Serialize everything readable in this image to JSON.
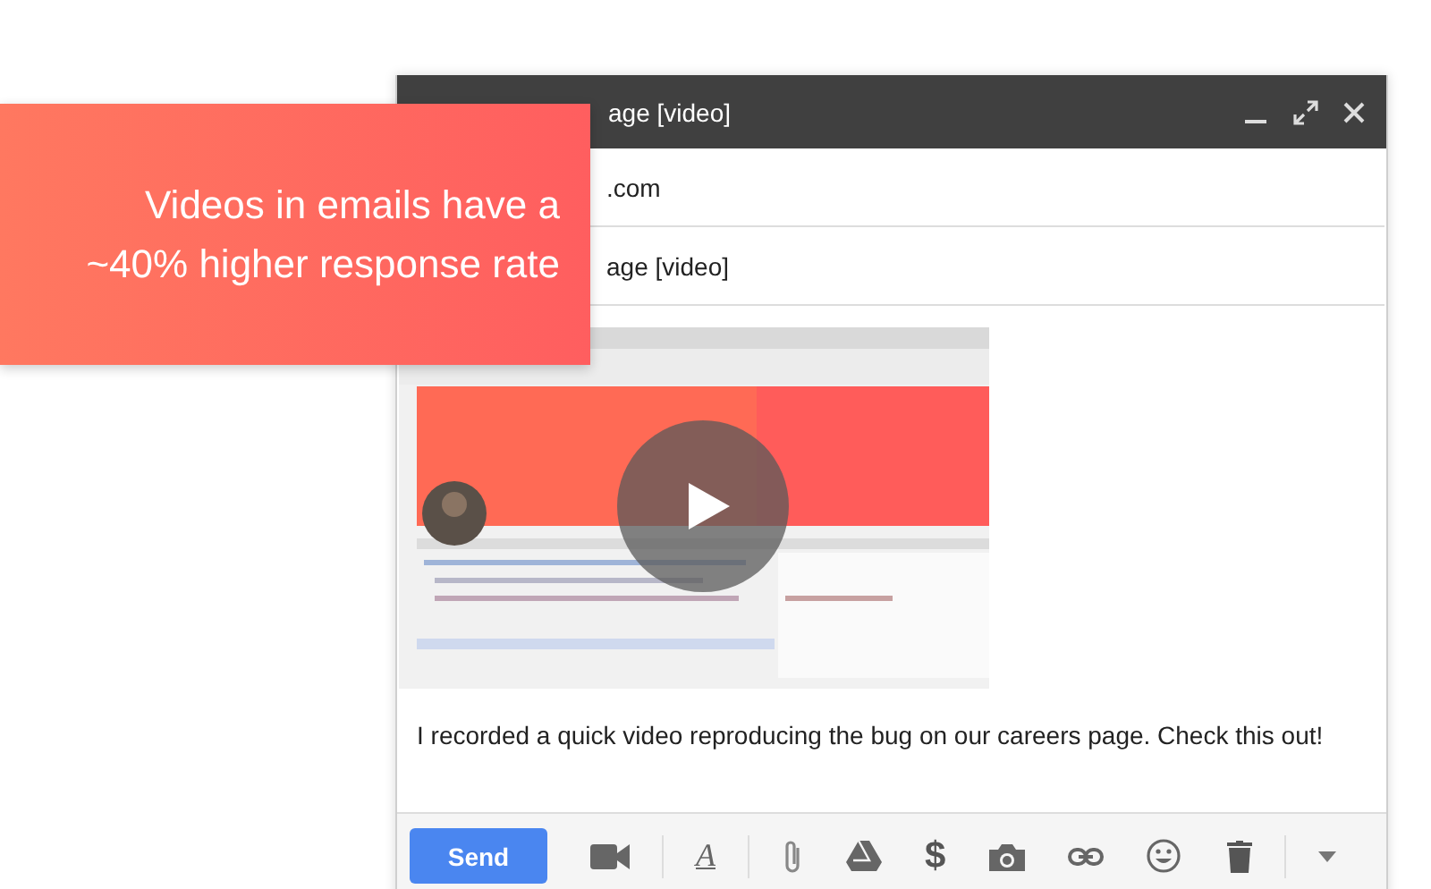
{
  "banner": {
    "lines": [
      "Videos in emails have a",
      "~40% higher response rate"
    ]
  },
  "compose": {
    "title": "age [video]",
    "to": ".com",
    "subject": "age [video]",
    "body": "I recorded a quick video reproducing the bug on our careers page. Check this out!"
  },
  "toolbar": {
    "send": "Send",
    "format_symbol": "A",
    "money_symbol": "$"
  }
}
